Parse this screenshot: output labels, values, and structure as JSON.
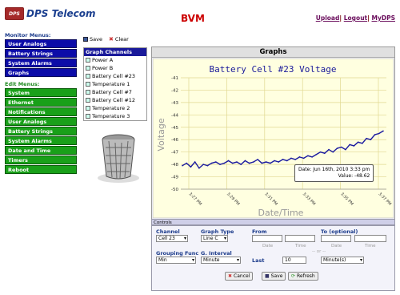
{
  "brand": {
    "mark": "DPS",
    "name": "DPS Telecom"
  },
  "app_title": "BVM",
  "top_links": {
    "upload": "Upload",
    "sep1": "|",
    "logout": "Logout",
    "sep2": "|",
    "mydps": "MyDPS"
  },
  "monitor_menu": {
    "title": "Monitor Menus:",
    "items": [
      "User Analogs",
      "Battery Strings",
      "System Alarms",
      "Graphs"
    ]
  },
  "edit_menu": {
    "title": "Edit Menus:",
    "items": [
      "System",
      "Ethernet",
      "Notifications",
      "User Analogs",
      "Battery Strings",
      "System Alarms",
      "Date and Time",
      "Timers",
      "Reboot"
    ]
  },
  "toolbar": {
    "save": "Save",
    "clear": "Clear"
  },
  "channels": {
    "title": "Graph Channels",
    "items": [
      "Power A",
      "Power B",
      "Battery Cell #23",
      "Temperature 1",
      "Battery Cell #7",
      "Battery Cell #12",
      "Temperature 2",
      "Temperature 3"
    ]
  },
  "panel_title": "Graphs",
  "chart_data": {
    "type": "line",
    "title": "Battery Cell #23 Voltage",
    "xlabel": "Date/Time",
    "ylabel": "Voltage",
    "ylim": [
      -50,
      -41
    ],
    "yticks": [
      -41,
      -42,
      -43,
      -44,
      -45,
      -46,
      -47,
      -48,
      -49,
      -50
    ],
    "xticks": [
      "3:27 PM",
      "3:29 PM",
      "3:31 PM",
      "3:33 PM",
      "3:35 PM",
      "3:37 PM"
    ],
    "grid": true,
    "series": [
      {
        "color": "#1a1aa0",
        "x": [
          0,
          1,
          2,
          3,
          4,
          5,
          6,
          7,
          8,
          9,
          10,
          11,
          12,
          13,
          14,
          15,
          16,
          17,
          18,
          19,
          20,
          21,
          22,
          23,
          24,
          25,
          26,
          27,
          28,
          29,
          30,
          31,
          32,
          33,
          34,
          35,
          36,
          37,
          38,
          39,
          40,
          41,
          42,
          43,
          44,
          45,
          46,
          47,
          48
        ],
        "values": [
          -48.1,
          -47.9,
          -48.2,
          -47.8,
          -48.3,
          -48.0,
          -48.1,
          -47.9,
          -47.8,
          -48.0,
          -47.9,
          -47.7,
          -47.9,
          -47.8,
          -48.0,
          -47.7,
          -47.9,
          -47.8,
          -47.6,
          -47.9,
          -47.8,
          -47.9,
          -47.7,
          -47.8,
          -47.6,
          -47.7,
          -47.5,
          -47.6,
          -47.4,
          -47.5,
          -47.3,
          -47.4,
          -47.2,
          -47.0,
          -47.1,
          -46.8,
          -47.0,
          -46.7,
          -46.6,
          -46.8,
          -46.4,
          -46.5,
          -46.2,
          -46.3,
          -45.9,
          -46.0,
          -45.6,
          -45.5,
          -45.3
        ]
      }
    ],
    "tooltip": {
      "date": "Date: Jun 16th, 2010 3:33 pm",
      "value": "Value: -48.62"
    }
  },
  "controls": {
    "title": "Controls",
    "channel_label": "Channel",
    "channel_value": "Cell 23",
    "graph_type_label": "Graph Type",
    "graph_type_value": "Line C",
    "from_label": "From",
    "to_label": "To (optional)",
    "date_sub": "Date",
    "time_sub": "Time",
    "grouping_label": "Grouping Func",
    "grouping_value": "Min",
    "interval_label": "G. Interval",
    "interval_value": "Minute",
    "or_text": "-- or --",
    "last_label": "Last",
    "last_value": "10",
    "last_unit": "Minute(s)",
    "cancel": "Cancel",
    "save": "Save",
    "refresh": "Refresh"
  }
}
